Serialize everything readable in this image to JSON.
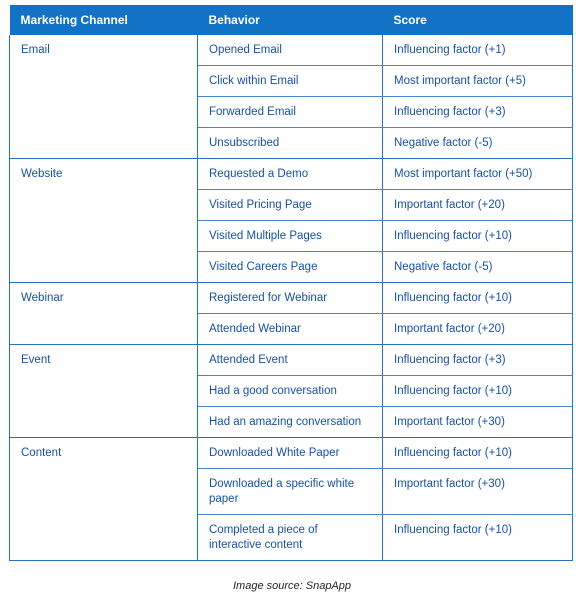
{
  "table": {
    "columns": [
      {
        "key": "channel",
        "label": "Marketing Channel"
      },
      {
        "key": "behavior",
        "label": "Behavior"
      },
      {
        "key": "score",
        "label": "Score"
      }
    ],
    "header_background": "#1273c6",
    "header_text_color": "#ffffff",
    "body_text_color": "#17509e",
    "border_color": "#2a6fc0",
    "groups": [
      {
        "channel": "Email",
        "rows": [
          {
            "behavior": "Opened Email",
            "score": "Influencing factor (+1)"
          },
          {
            "behavior": "Click within Email",
            "score": "Most important factor (+5)"
          },
          {
            "behavior": "Forwarded Email",
            "score": "Influencing factor (+3)"
          },
          {
            "behavior": "Unsubscribed",
            "score": "Negative factor (-5)"
          }
        ]
      },
      {
        "channel": "Website",
        "rows": [
          {
            "behavior": "Requested a Demo",
            "score": "Most important factor (+50)"
          },
          {
            "behavior": "Visited Pricing Page",
            "score": "Important factor (+20)"
          },
          {
            "behavior": "Visited Multiple Pages",
            "score": "Influencing factor (+10)"
          },
          {
            "behavior": "Visited Careers Page",
            "score": "Negative factor (-5)"
          }
        ]
      },
      {
        "channel": "Webinar",
        "rows": [
          {
            "behavior": "Registered for Webinar",
            "score": "Influencing factor (+10)"
          },
          {
            "behavior": "Attended Webinar",
            "score": "Important factor (+20)"
          }
        ]
      },
      {
        "channel": "Event",
        "rows": [
          {
            "behavior": "Attended Event",
            "score": "Influencing factor (+3)"
          },
          {
            "behavior": "Had a good conversation",
            "score": "Influencing factor (+10)"
          },
          {
            "behavior": "Had an amazing conversation",
            "score": "Important factor (+30)",
            "wrap": true
          }
        ]
      },
      {
        "channel": "Content",
        "rows": [
          {
            "behavior": "Downloaded White Paper",
            "score": "Influencing factor (+10)"
          },
          {
            "behavior": "Downloaded a specific white paper",
            "score": "Important factor (+30)",
            "wrap": true
          },
          {
            "behavior": "Completed a piece of interactive content",
            "score": "Influencing factor (+10)",
            "wrap": true
          }
        ]
      }
    ]
  },
  "caption": "Image source: SnapApp"
}
